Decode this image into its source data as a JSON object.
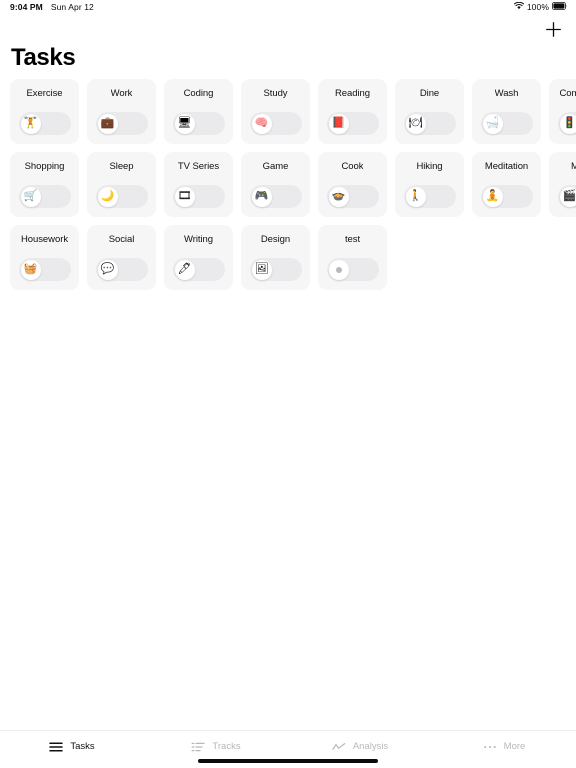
{
  "status_bar": {
    "time": "9:04 PM",
    "date": "Sun Apr 12",
    "battery_percent": "100%",
    "wifi_icon": "wifi-icon",
    "battery_icon": "battery-full-icon"
  },
  "header": {
    "title": "Tasks",
    "add_icon": "plus-icon"
  },
  "tasks": [
    {
      "label": "Exercise",
      "icon": "🏋",
      "icon_name": "dumbbell-icon",
      "enabled": false
    },
    {
      "label": "Work",
      "icon": "💼",
      "icon_name": "briefcase-icon",
      "enabled": false
    },
    {
      "label": "Coding",
      "icon": "🖥",
      "icon_name": "code-brackets-icon",
      "enabled": false
    },
    {
      "label": "Study",
      "icon": "🧠",
      "icon_name": "brain-icon",
      "enabled": false
    },
    {
      "label": "Reading",
      "icon": "📕",
      "icon_name": "book-icon",
      "enabled": false
    },
    {
      "label": "Dine",
      "icon": "🍽",
      "icon_name": "fork-knife-plate-icon",
      "enabled": false
    },
    {
      "label": "Wash",
      "icon": "🛁",
      "icon_name": "bathtub-icon",
      "enabled": false
    },
    {
      "label": "Commuting",
      "icon": "🚦",
      "icon_name": "traffic-light-icon",
      "enabled": false
    },
    {
      "label": "Shopping",
      "icon": "🛒",
      "icon_name": "shopping-cart-icon",
      "enabled": false
    },
    {
      "label": "Sleep",
      "icon": "🌙",
      "icon_name": "crescent-moon-icon",
      "enabled": false
    },
    {
      "label": "TV Series",
      "icon": "🎞",
      "icon_name": "film-strip-icon",
      "enabled": false
    },
    {
      "label": "Game",
      "icon": "🎮",
      "icon_name": "game-controller-icon",
      "enabled": false
    },
    {
      "label": "Cook",
      "icon": "🍲",
      "icon_name": "cooking-pot-icon",
      "enabled": false
    },
    {
      "label": "Hiking",
      "icon": "🚶",
      "icon_name": "hiker-icon",
      "enabled": false
    },
    {
      "label": "Meditation",
      "icon": "🧘",
      "icon_name": "meditation-icon",
      "enabled": false
    },
    {
      "label": "Movie",
      "icon": "🎬",
      "icon_name": "movie-frame-icon",
      "enabled": false
    },
    {
      "label": "Housework",
      "icon": "🧺",
      "icon_name": "washing-machine-icon",
      "enabled": false
    },
    {
      "label": "Social",
      "icon": "💬",
      "icon_name": "chat-bubbles-icon",
      "enabled": false
    },
    {
      "label": "Writing",
      "icon": "🖊",
      "icon_name": "pen-icon",
      "enabled": false
    },
    {
      "label": "Design",
      "icon": "🖼",
      "icon_name": "picture-frame-icon",
      "enabled": false
    },
    {
      "label": "test",
      "icon": "",
      "icon_name": "default-dot-icon",
      "enabled": false
    }
  ],
  "tab_bar": {
    "items": [
      {
        "label": "Tasks",
        "icon_name": "hamburger-icon",
        "active": true
      },
      {
        "label": "Tracks",
        "icon_name": "list-icon",
        "active": false
      },
      {
        "label": "Analysis",
        "icon_name": "line-chart-icon",
        "active": false
      },
      {
        "label": "More",
        "icon_name": "ellipsis-icon",
        "active": false
      }
    ]
  },
  "colors": {
    "card_background": "#f6f6f7",
    "toggle_track": "#eaeaec",
    "toggle_knob": "#ffffff",
    "text_primary": "#111111",
    "text_muted": "#b8b8bb",
    "page_background": "#ffffff"
  }
}
